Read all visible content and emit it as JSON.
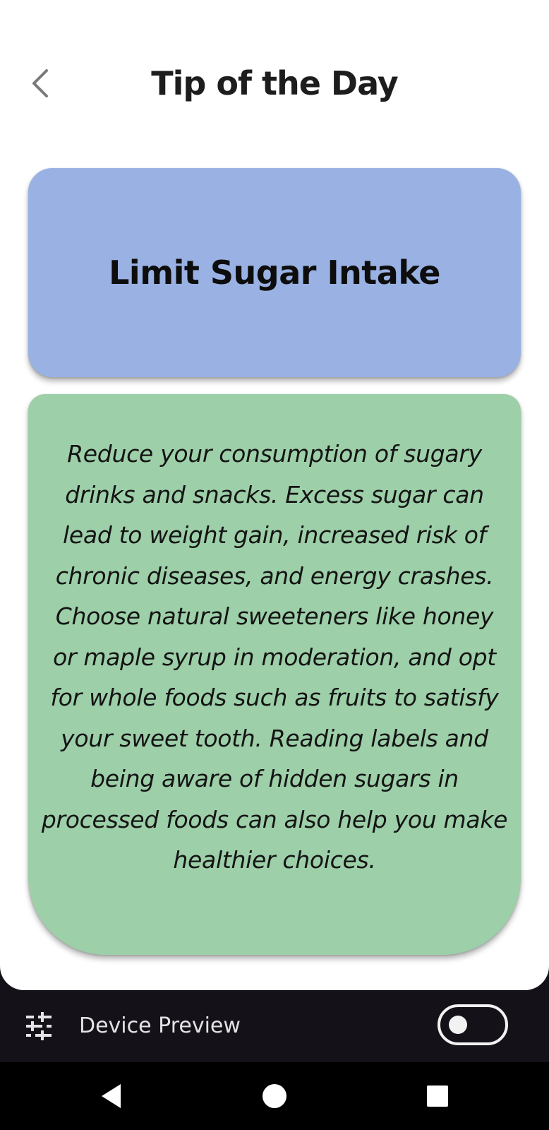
{
  "header": {
    "title": "Tip of the Day",
    "back_icon": "chevron-left-icon"
  },
  "tip": {
    "title": "Limit Sugar Intake",
    "body": "Reduce your consumption of sugary drinks and snacks. Excess sugar can lead to weight gain, increased risk of chronic diseases, and energy crashes. Choose natural sweeteners like honey or maple syrup in moderation, and opt for whole foods such as fruits to satisfy your sweet tooth. Reading labels and being aware of hidden sugars in processed foods can also help you make healthier choices.",
    "title_card_color": "#99b2e3",
    "body_card_color": "#9dcfa9"
  },
  "device_preview": {
    "label": "Device Preview",
    "settings_icon": "tune-icon",
    "toggle_on": false
  },
  "system_nav": {
    "back_icon": "triangle-back-icon",
    "home_icon": "circle-home-icon",
    "recents_icon": "square-recents-icon"
  }
}
